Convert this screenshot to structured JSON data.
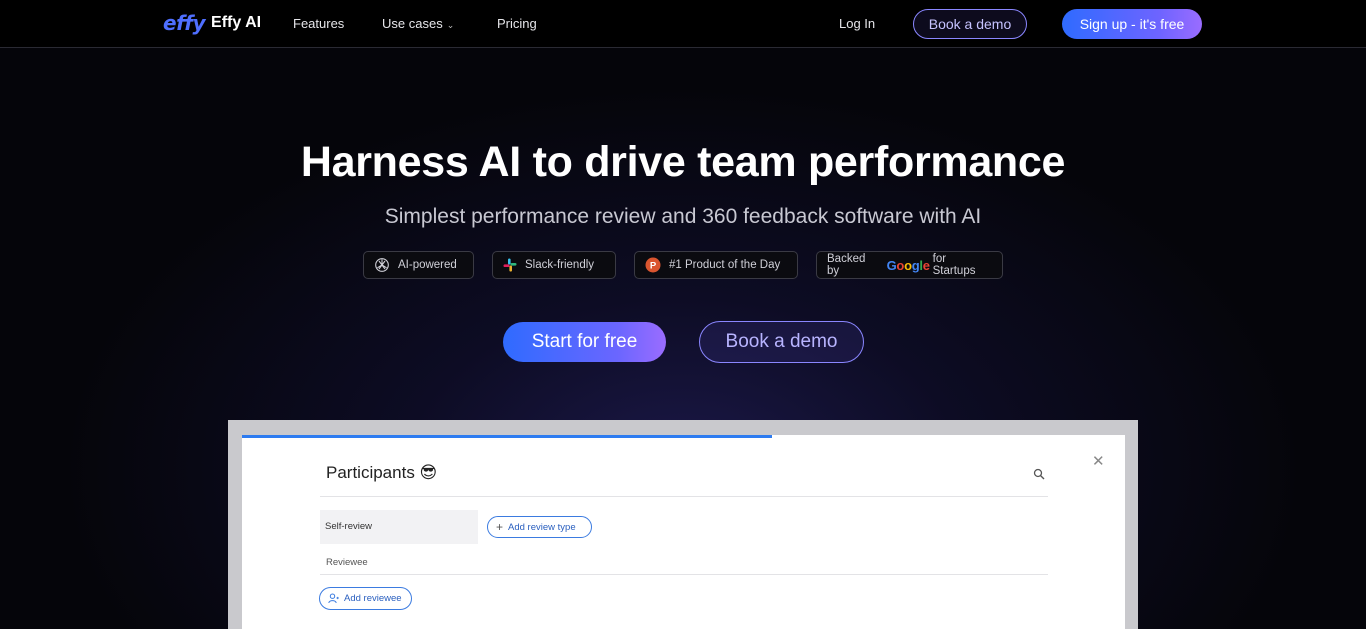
{
  "nav": {
    "logo_mark": "effy",
    "logo_text": "Effy AI",
    "features": "Features",
    "use_cases": "Use cases",
    "pricing": "Pricing",
    "login": "Log In",
    "book_demo": "Book a demo",
    "signup": "Sign up - it's free"
  },
  "hero": {
    "title": "Harness AI to drive team performance",
    "subtitle": "Simplest performance review and 360 feedback software with AI",
    "badges": {
      "ai": "AI-powered",
      "slack": "Slack-friendly",
      "product": "#1 Product of the Day",
      "backed": "Backed by",
      "google_startups": "for Startups"
    },
    "start_free": "Start for free",
    "book_demo": "Book a demo"
  },
  "preview": {
    "title": "Participants 😎",
    "close": "✕",
    "self_review": "Self-review",
    "add_review_type": "Add review type",
    "reviewee": "Reviewee",
    "add_reviewee": "Add reviewee"
  },
  "colors": {
    "accent_blue": "#2f6bff",
    "accent_purple": "#8a86ff",
    "background": "#05050a"
  }
}
